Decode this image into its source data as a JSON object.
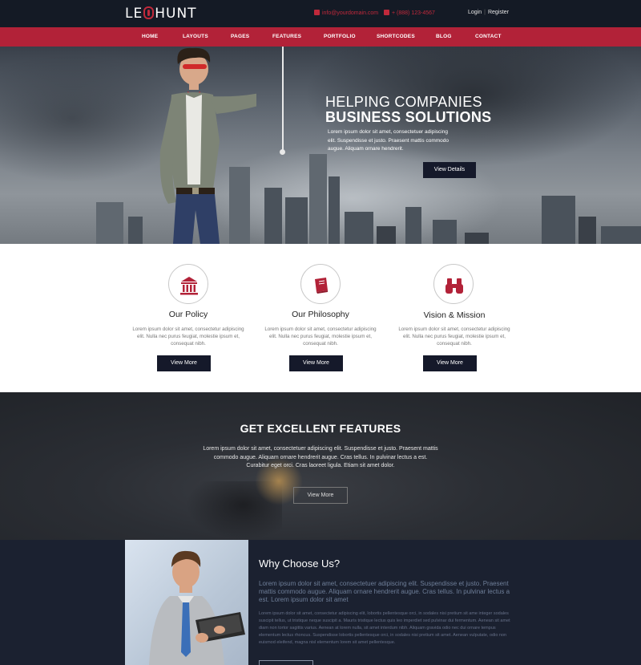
{
  "brand": {
    "logo_left": "LE",
    "logo_right": "HUNT"
  },
  "topbar": {
    "email": "info@yourdomain.com",
    "phone": "+ (888) 123-4567",
    "login": "Login",
    "separator": "|",
    "register": "Register"
  },
  "nav": {
    "items": [
      {
        "label": "HOME"
      },
      {
        "label": "LAYOUTS"
      },
      {
        "label": "PAGES"
      },
      {
        "label": "FEATURES"
      },
      {
        "label": "PORTFOLIO"
      },
      {
        "label": "SHORTCODES"
      },
      {
        "label": "BLOG"
      },
      {
        "label": "CONTACT"
      }
    ]
  },
  "hero": {
    "title_line1": "HELPING COMPANIES",
    "title_line2": "BUSINESS SOLUTIONS",
    "description": "Lorem ipsum dolor sit amet, consectetuer adipiscing elit. Suspendisse et justo. Praesent mattis commodo augue. Aliquam ornare hendrerit.",
    "button": "View Details"
  },
  "services": [
    {
      "icon": "bank-icon",
      "title": "Our Policy",
      "text": "Lorem ipsum dolor sit amet, consectetur adipiscing elit. Nulla nec purus feugiat, molestie ipsum et, consequat nibh.",
      "button": "View More"
    },
    {
      "icon": "book-icon",
      "title": "Our Philosophy",
      "text": "Lorem ipsum dolor sit amet, consectetur adipiscing elit. Nulla nec purus feugiat, molestie ipsum et, consequat nibh.",
      "button": "View More"
    },
    {
      "icon": "binoculars-icon",
      "title": "Vision & Mission",
      "text": "Lorem ipsum dolor sit amet, consectetur adipiscing elit. Nulla nec purus feugiat, molestie ipsum et, consequat nibh.",
      "button": "View More"
    }
  ],
  "excellent": {
    "title": "GET EXCELLENT FEATURES",
    "text": "Lorem ipsum dolor sit amet, consectetuer adipiscing elit. Suspendisse et justo. Praesent mattis commodo augue. Aliquam ornare hendrerit augue. Cras tellus. In pulvinar lectus a est. Curabitur eget orci. Cras laoreet ligula. Etiam sit amet dolor.",
    "button": "View More"
  },
  "why": {
    "title": "Why Choose Us?",
    "lead": "Lorem ipsum dolor sit amet, consectetuer adipiscing elit. Suspendisse et justo. Praesent mattis commodo augue. Aliquam ornare hendrerit augue. Cras tellus. In pulvinar lectus a est. Lorem ipsum dolor sit amet",
    "body": "Lorem ipsum dolor sit amet, consectetur adipiscing elit, lobortis pellentesque orci, in sodales nisi pretium sit ame integer sodales suscipit tellus, ut tristique neque suscipit a. Mauris tristique lectus quis leo imperdiet sed pulvinar dui fermentum. Aenean sit amet diam non tortor sagittis varius. Aenean at lorem nulla, sit amet interdum nibh. Aliquam gravida odio nec dui ornare tempus elementum lectus rhoncus. Suspendisse lobortis pellentesque orci, in sodales nisi pretium sit amet. Aenean vulputate, odio non euismod eleifend, magna nisl elementum lorem sit amet pellentesque."
  },
  "colors": {
    "accent": "#b22238",
    "dark_navy": "#141a25",
    "button_dark": "#15192a"
  }
}
